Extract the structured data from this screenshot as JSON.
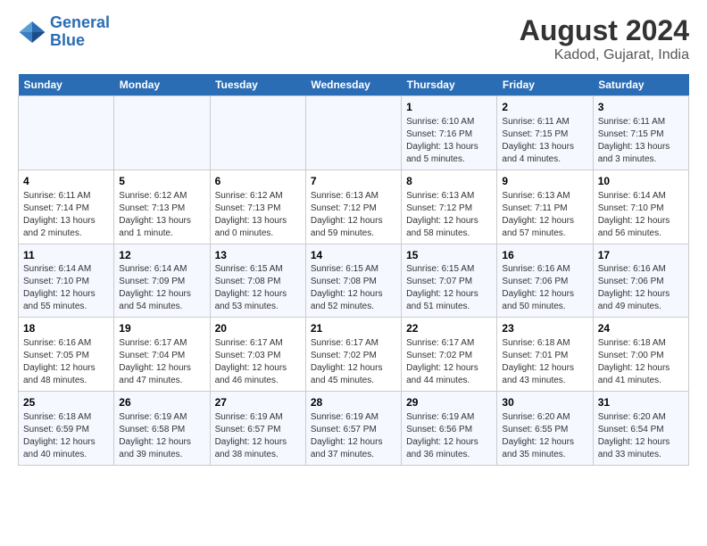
{
  "header": {
    "logo_line1": "General",
    "logo_line2": "Blue",
    "title": "August 2024",
    "subtitle": "Kadod, Gujarat, India"
  },
  "days_of_week": [
    "Sunday",
    "Monday",
    "Tuesday",
    "Wednesday",
    "Thursday",
    "Friday",
    "Saturday"
  ],
  "weeks": [
    [
      {
        "num": "",
        "info": ""
      },
      {
        "num": "",
        "info": ""
      },
      {
        "num": "",
        "info": ""
      },
      {
        "num": "",
        "info": ""
      },
      {
        "num": "1",
        "info": "Sunrise: 6:10 AM\nSunset: 7:16 PM\nDaylight: 13 hours\nand 5 minutes."
      },
      {
        "num": "2",
        "info": "Sunrise: 6:11 AM\nSunset: 7:15 PM\nDaylight: 13 hours\nand 4 minutes."
      },
      {
        "num": "3",
        "info": "Sunrise: 6:11 AM\nSunset: 7:15 PM\nDaylight: 13 hours\nand 3 minutes."
      }
    ],
    [
      {
        "num": "4",
        "info": "Sunrise: 6:11 AM\nSunset: 7:14 PM\nDaylight: 13 hours\nand 2 minutes."
      },
      {
        "num": "5",
        "info": "Sunrise: 6:12 AM\nSunset: 7:13 PM\nDaylight: 13 hours\nand 1 minute."
      },
      {
        "num": "6",
        "info": "Sunrise: 6:12 AM\nSunset: 7:13 PM\nDaylight: 13 hours\nand 0 minutes."
      },
      {
        "num": "7",
        "info": "Sunrise: 6:13 AM\nSunset: 7:12 PM\nDaylight: 12 hours\nand 59 minutes."
      },
      {
        "num": "8",
        "info": "Sunrise: 6:13 AM\nSunset: 7:12 PM\nDaylight: 12 hours\nand 58 minutes."
      },
      {
        "num": "9",
        "info": "Sunrise: 6:13 AM\nSunset: 7:11 PM\nDaylight: 12 hours\nand 57 minutes."
      },
      {
        "num": "10",
        "info": "Sunrise: 6:14 AM\nSunset: 7:10 PM\nDaylight: 12 hours\nand 56 minutes."
      }
    ],
    [
      {
        "num": "11",
        "info": "Sunrise: 6:14 AM\nSunset: 7:10 PM\nDaylight: 12 hours\nand 55 minutes."
      },
      {
        "num": "12",
        "info": "Sunrise: 6:14 AM\nSunset: 7:09 PM\nDaylight: 12 hours\nand 54 minutes."
      },
      {
        "num": "13",
        "info": "Sunrise: 6:15 AM\nSunset: 7:08 PM\nDaylight: 12 hours\nand 53 minutes."
      },
      {
        "num": "14",
        "info": "Sunrise: 6:15 AM\nSunset: 7:08 PM\nDaylight: 12 hours\nand 52 minutes."
      },
      {
        "num": "15",
        "info": "Sunrise: 6:15 AM\nSunset: 7:07 PM\nDaylight: 12 hours\nand 51 minutes."
      },
      {
        "num": "16",
        "info": "Sunrise: 6:16 AM\nSunset: 7:06 PM\nDaylight: 12 hours\nand 50 minutes."
      },
      {
        "num": "17",
        "info": "Sunrise: 6:16 AM\nSunset: 7:06 PM\nDaylight: 12 hours\nand 49 minutes."
      }
    ],
    [
      {
        "num": "18",
        "info": "Sunrise: 6:16 AM\nSunset: 7:05 PM\nDaylight: 12 hours\nand 48 minutes."
      },
      {
        "num": "19",
        "info": "Sunrise: 6:17 AM\nSunset: 7:04 PM\nDaylight: 12 hours\nand 47 minutes."
      },
      {
        "num": "20",
        "info": "Sunrise: 6:17 AM\nSunset: 7:03 PM\nDaylight: 12 hours\nand 46 minutes."
      },
      {
        "num": "21",
        "info": "Sunrise: 6:17 AM\nSunset: 7:02 PM\nDaylight: 12 hours\nand 45 minutes."
      },
      {
        "num": "22",
        "info": "Sunrise: 6:17 AM\nSunset: 7:02 PM\nDaylight: 12 hours\nand 44 minutes."
      },
      {
        "num": "23",
        "info": "Sunrise: 6:18 AM\nSunset: 7:01 PM\nDaylight: 12 hours\nand 43 minutes."
      },
      {
        "num": "24",
        "info": "Sunrise: 6:18 AM\nSunset: 7:00 PM\nDaylight: 12 hours\nand 41 minutes."
      }
    ],
    [
      {
        "num": "25",
        "info": "Sunrise: 6:18 AM\nSunset: 6:59 PM\nDaylight: 12 hours\nand 40 minutes."
      },
      {
        "num": "26",
        "info": "Sunrise: 6:19 AM\nSunset: 6:58 PM\nDaylight: 12 hours\nand 39 minutes."
      },
      {
        "num": "27",
        "info": "Sunrise: 6:19 AM\nSunset: 6:57 PM\nDaylight: 12 hours\nand 38 minutes."
      },
      {
        "num": "28",
        "info": "Sunrise: 6:19 AM\nSunset: 6:57 PM\nDaylight: 12 hours\nand 37 minutes."
      },
      {
        "num": "29",
        "info": "Sunrise: 6:19 AM\nSunset: 6:56 PM\nDaylight: 12 hours\nand 36 minutes."
      },
      {
        "num": "30",
        "info": "Sunrise: 6:20 AM\nSunset: 6:55 PM\nDaylight: 12 hours\nand 35 minutes."
      },
      {
        "num": "31",
        "info": "Sunrise: 6:20 AM\nSunset: 6:54 PM\nDaylight: 12 hours\nand 33 minutes."
      }
    ]
  ]
}
